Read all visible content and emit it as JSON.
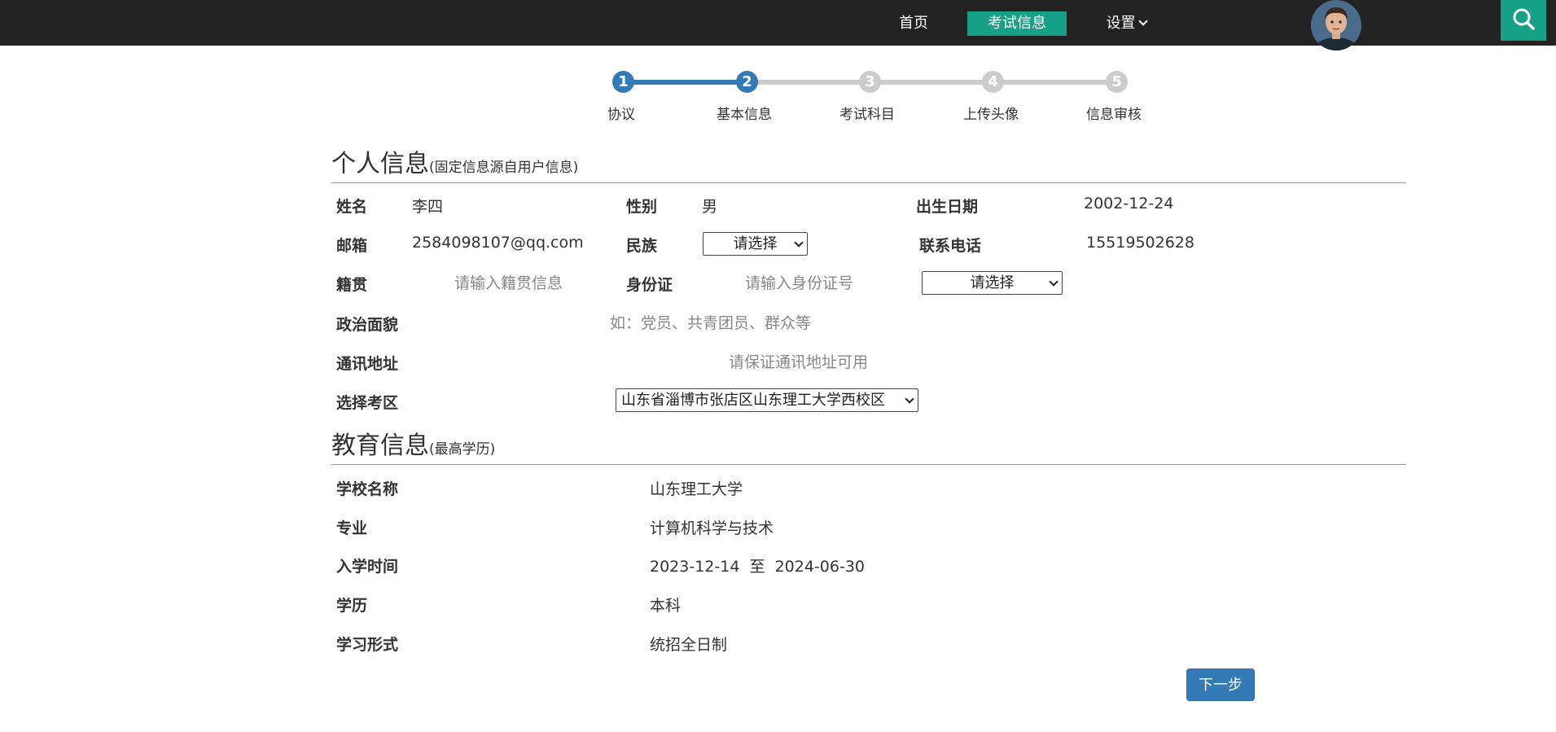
{
  "nav": {
    "home": "首页",
    "exam_info": "考试信息",
    "settings": "设置",
    "accent_color": "#16a085"
  },
  "steps": [
    {
      "num": "1",
      "label": "协议",
      "state": "done"
    },
    {
      "num": "2",
      "label": "基本信息",
      "state": "current"
    },
    {
      "num": "3",
      "label": "考试科目",
      "state": "todo"
    },
    {
      "num": "4",
      "label": "上传头像",
      "state": "todo"
    },
    {
      "num": "5",
      "label": "信息审核",
      "state": "todo"
    }
  ],
  "personal": {
    "title": "个人信息",
    "subtitle": "(固定信息源自用户信息)",
    "name_label": "姓名",
    "name_value": "李四",
    "gender_label": "性别",
    "gender_value": "男",
    "birth_label": "出生日期",
    "birth_value": "2002-12-24",
    "email_label": "邮箱",
    "email_value": "2584098107@qq.com",
    "ethnicity_label": "民族",
    "ethnicity_select": "请选择",
    "phone_label": "联系电话",
    "phone_value": "15519502628",
    "native_label": "籍贯",
    "native_placeholder": "请输入籍贯信息",
    "id_label": "身份证",
    "id_placeholder": "请输入身份证号",
    "id_type_select": "请选择",
    "political_label": "政治面貌",
    "political_placeholder": "如：党员、共青团员、群众等",
    "address_label": "通讯地址",
    "address_placeholder": "请保证通讯地址可用",
    "region_label": "选择考区",
    "region_select": "山东省淄博市张店区山东理工大学西校区"
  },
  "education": {
    "title": "教育信息",
    "subtitle": "(最高学历)",
    "school_label": "学校名称",
    "school_value": "山东理工大学",
    "major_label": "专业",
    "major_value": "计算机科学与技术",
    "enroll_label": "入学时间",
    "enroll_value": "2023-12-14  至  2024-06-30",
    "degree_label": "学历",
    "degree_value": "本科",
    "mode_label": "学习形式",
    "mode_value": "统招全日制"
  },
  "next_button": "下一步",
  "colors": {
    "primary": "#337ab7",
    "inactive": "#cccccc",
    "topbar": "#222222"
  }
}
